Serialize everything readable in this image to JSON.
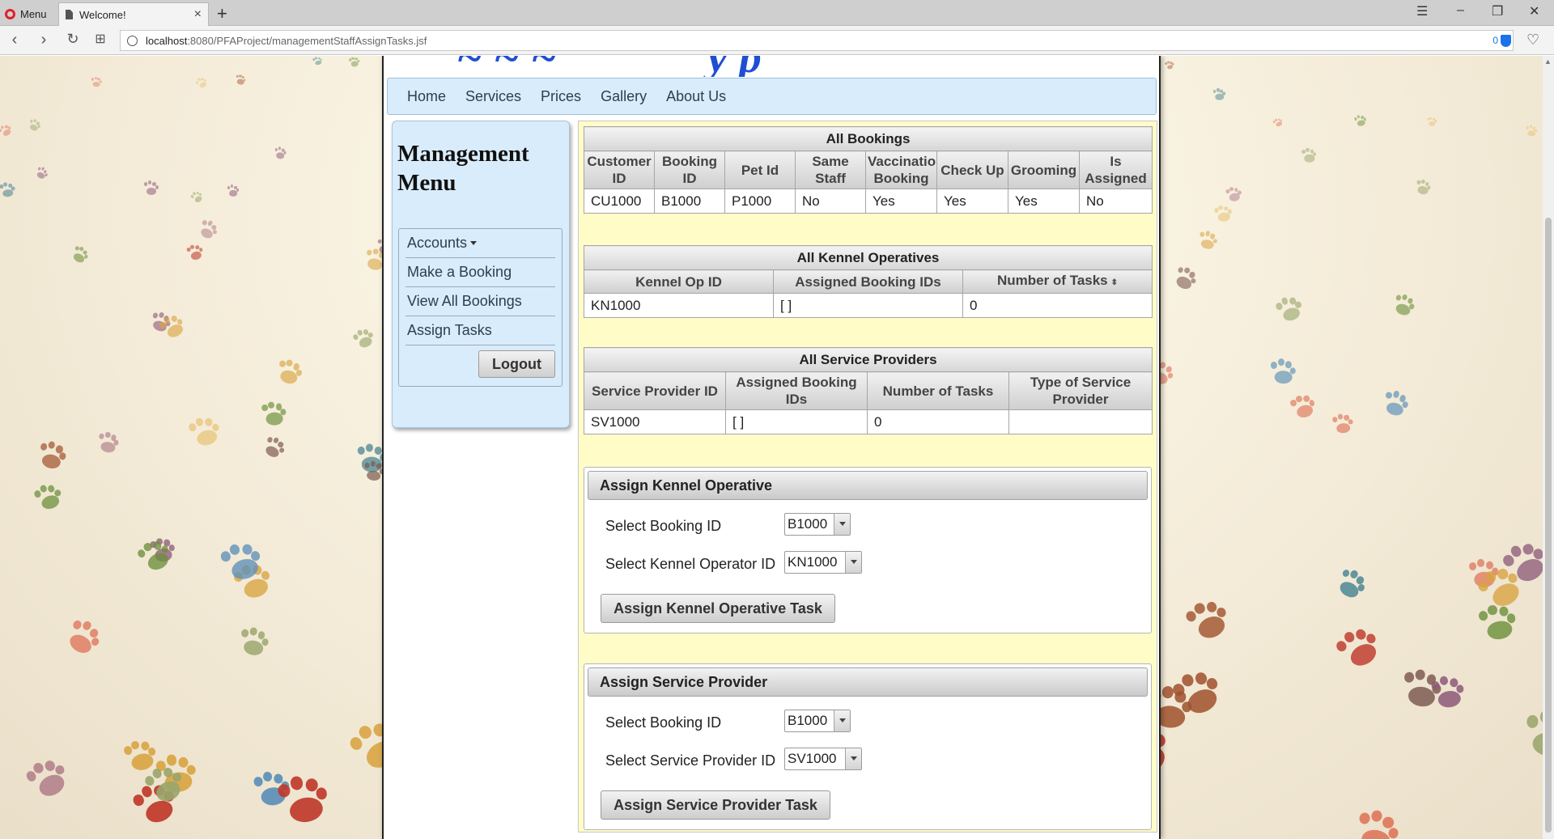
{
  "browser": {
    "menu_label": "Menu",
    "tab_title": "Welcome!",
    "new_tab": "+",
    "url_host": "localhost",
    "url_path": ":8080/PFAProject/managementStaffAssignTasks.jsf",
    "blocked_count": "0"
  },
  "nav": {
    "items": [
      "Home",
      "Services",
      "Prices",
      "Gallery",
      "About Us"
    ]
  },
  "sidebar": {
    "title": "Management Menu",
    "items": [
      "Accounts",
      "Make a Booking",
      "View All Bookings",
      "Assign Tasks"
    ],
    "logout": "Logout"
  },
  "bookings": {
    "title": "All Bookings",
    "headers": [
      "Customer ID",
      "Booking ID",
      "Pet Id",
      "Same Staff",
      "Vaccination Booking",
      "Check Up",
      "Grooming",
      "Is Assigned"
    ],
    "rows": [
      [
        "CU1000",
        "B1000",
        "P1000",
        "No",
        "Yes",
        "Yes",
        "Yes",
        "No"
      ]
    ]
  },
  "kennel_ops": {
    "title": "All Kennel Operatives",
    "headers": [
      "Kennel Op ID",
      "Assigned Booking IDs",
      "Number of Tasks"
    ],
    "rows": [
      [
        "KN1000",
        "[ ]",
        "0"
      ]
    ]
  },
  "service_providers": {
    "title": "All Service Providers",
    "headers": [
      "Service Provider ID",
      "Assigned Booking IDs",
      "Number of Tasks",
      "Type of Service Provider"
    ],
    "rows": [
      [
        "SV1000",
        "[ ]",
        "0",
        ""
      ]
    ]
  },
  "assign_kennel": {
    "title": "Assign Kennel Operative",
    "booking_label": "Select Booking ID",
    "booking_value": "B1000",
    "operator_label": "Select Kennel Operator ID",
    "operator_value": "KN1000",
    "button": "Assign Kennel Operative Task"
  },
  "assign_service": {
    "title": "Assign Service Provider",
    "booking_label": "Select Booking ID",
    "booking_value": "B1000",
    "provider_label": "Select Service Provider ID",
    "provider_value": "SV1000",
    "button": "Assign Service Provider Task"
  },
  "colors": {
    "nav_bg": "#d9ecfb",
    "content_bg": "#fffcc8",
    "paw_red": "#c0392b",
    "paw_teal": "#3f7f8f"
  }
}
